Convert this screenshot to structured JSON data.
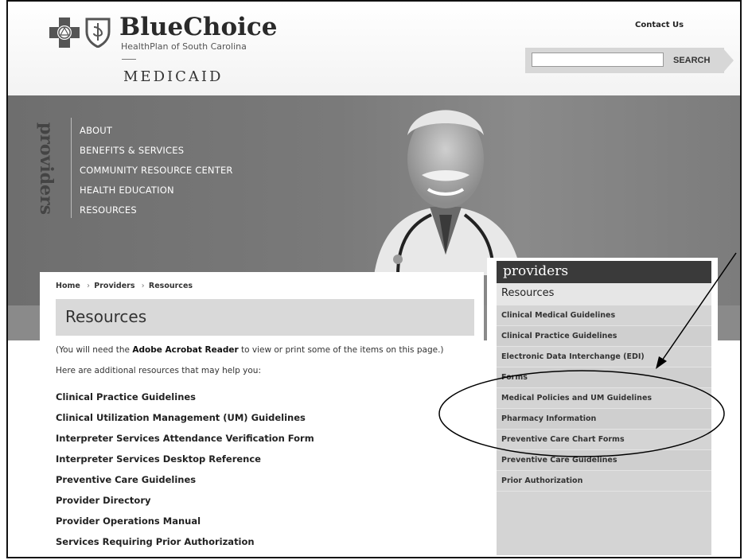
{
  "brand": {
    "name": "BlueChoice",
    "tagline": "HealthPlan of South Carolina",
    "program": "MEDICAID"
  },
  "header": {
    "contact_label": "Contact Us",
    "search_placeholder": "",
    "search_button": "SEARCH"
  },
  "hero": {
    "section_label": "providers",
    "nav": [
      "ABOUT",
      "BENEFITS & SERVICES",
      "COMMUNITY RESOURCE CENTER",
      "HEALTH EDUCATION",
      "RESOURCES"
    ]
  },
  "breadcrumb": [
    "Home",
    "Providers",
    "Resources"
  ],
  "breadcrumb_separator": "›",
  "page": {
    "title": "Resources",
    "note_prefix": "(You will need the ",
    "note_bold": "Adobe Acrobat Reader",
    "note_suffix": " to view or print some of the items on this page.)",
    "intro": "Here are additional resources that may help you:",
    "links": [
      "Clinical Practice Guidelines",
      "Clinical Utilization Management (UM) Guidelines",
      "Interpreter Services Attendance Verification Form",
      "Interpreter Services Desktop Reference",
      "Preventive Care Guidelines",
      "Provider Directory",
      "Provider Operations Manual",
      "Services Requiring Prior Authorization"
    ]
  },
  "sidebar": {
    "heading": "providers",
    "subheading": "Resources",
    "items": [
      "Clinical Medical Guidelines",
      "Clinical Practice Guidelines",
      "Electronic Data Interchange (EDI)",
      "Forms",
      "Medical Policies and UM Guidelines",
      "Pharmacy Information",
      "Preventive Care Chart Forms",
      "Preventive Care Guidelines",
      "Prior Authorization"
    ]
  }
}
